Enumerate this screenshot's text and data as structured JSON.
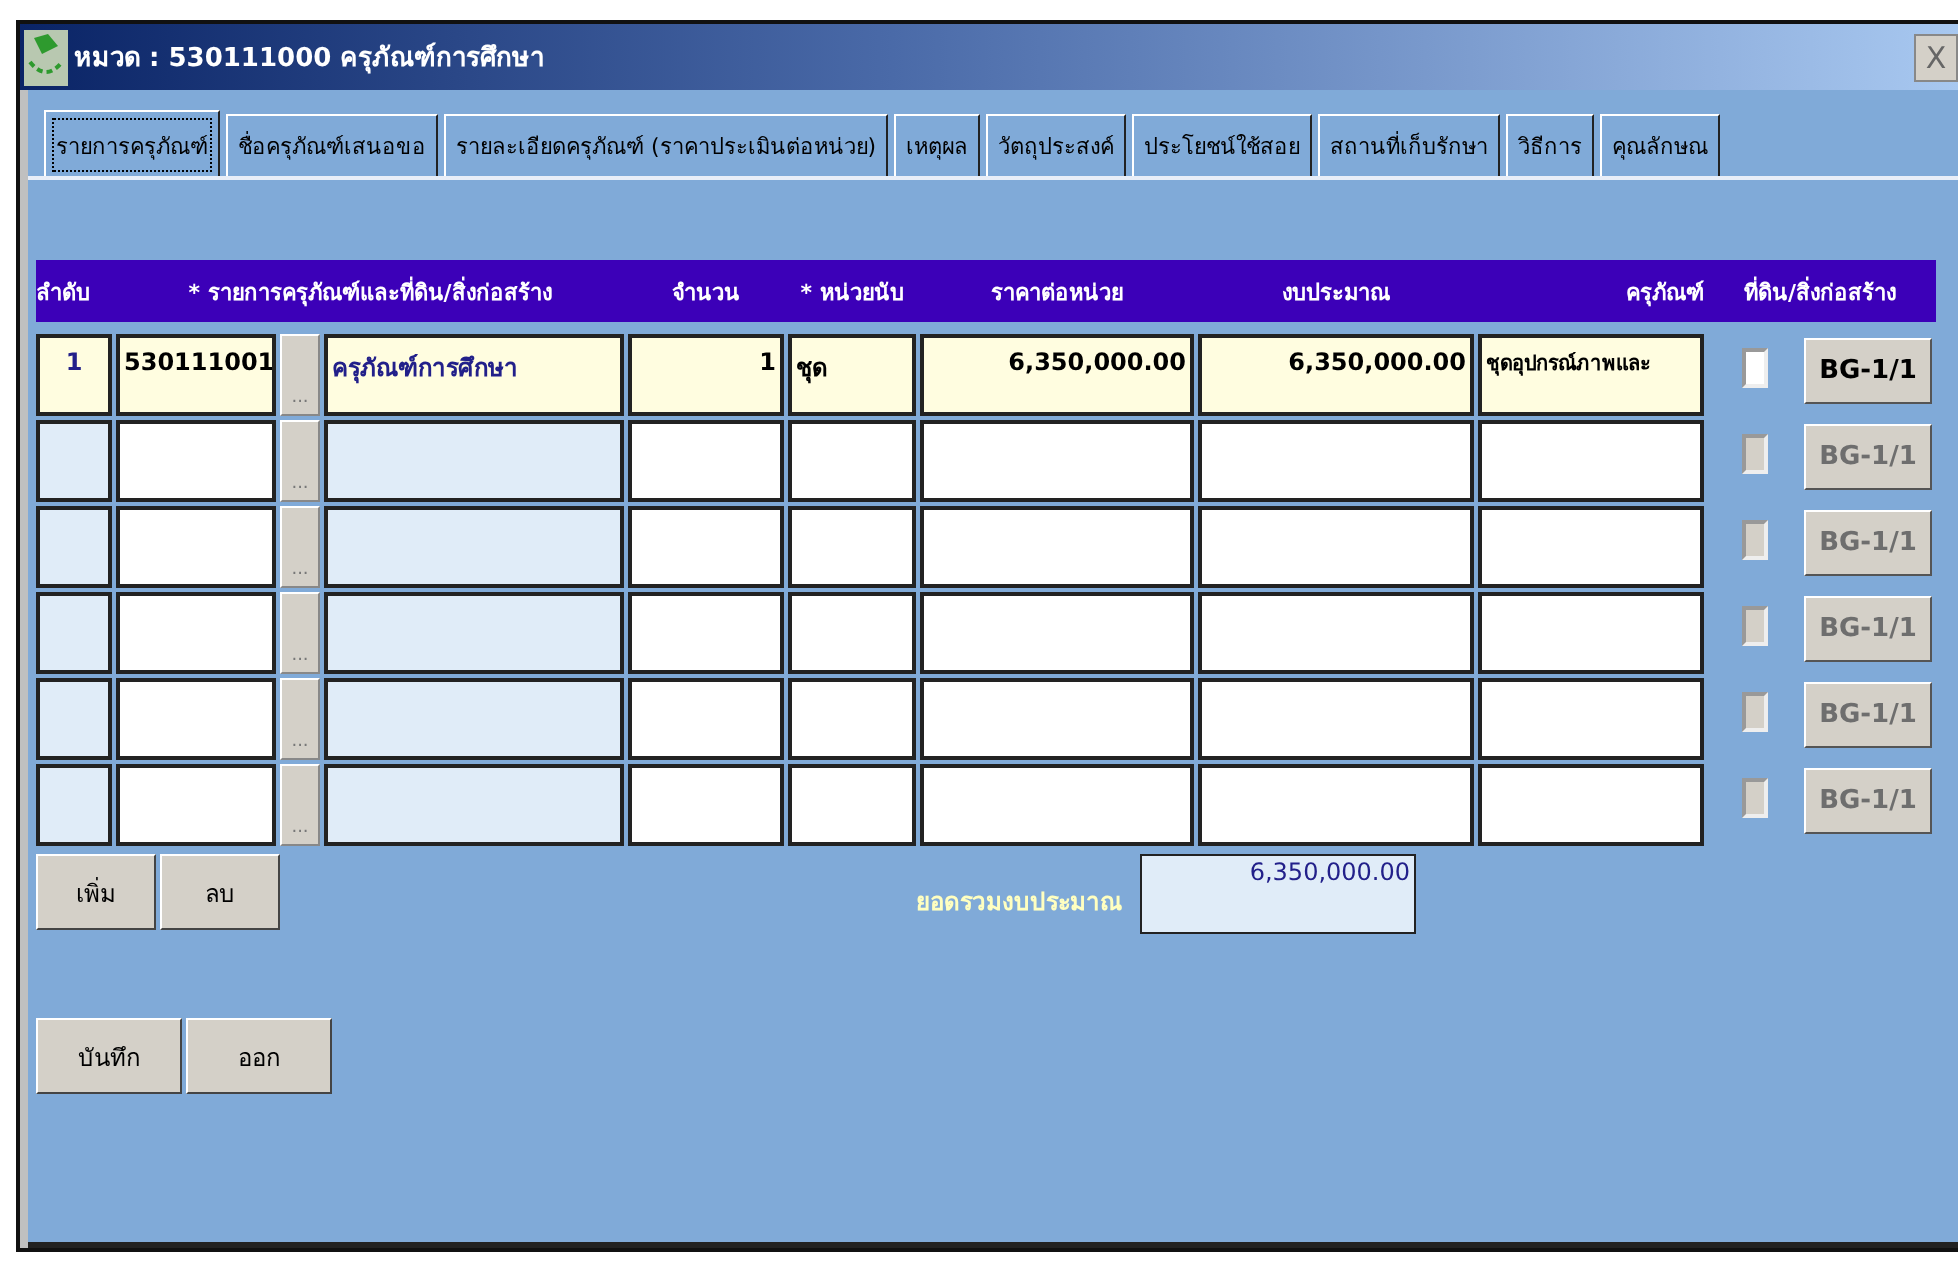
{
  "window": {
    "title": "หมวด : 530111000 ครุภัณฑ์การศึกษา",
    "close": "X"
  },
  "tabs": [
    {
      "label": "รายการครุภัณฑ์",
      "selected": true
    },
    {
      "label": "ชื่อครุภัณฑ์เสนอขอ",
      "selected": false
    },
    {
      "label": "รายละเอียดครุภัณฑ์ (ราคาประเมินต่อหน่วย)",
      "selected": false
    },
    {
      "label": "เหตุผล",
      "selected": false
    },
    {
      "label": "วัตถุประสงค์",
      "selected": false
    },
    {
      "label": "ประโยชน์ใช้สอย",
      "selected": false
    },
    {
      "label": "สถานที่เก็บรักษา",
      "selected": false
    },
    {
      "label": "วิธีการ",
      "selected": false
    },
    {
      "label": "คุณลักษณ",
      "selected": false
    }
  ],
  "table": {
    "columns": [
      "ลำดับ",
      "* รายการครุภัณฑ์และที่ดิน/สิ่งก่อสร้าง",
      "จำนวน",
      "* หน่วยนับ",
      "ราคาต่อหน่วย",
      "งบประมาณ",
      "ครุภัณฑ์",
      "ที่ดิน/สิ่งก่อสร้าง"
    ],
    "rows": [
      {
        "selected": true,
        "disabled": false,
        "seq": "1",
        "code": "530111001",
        "picker": "...",
        "name": "ครุภัณฑ์การศึกษา",
        "qty": "1",
        "unit": "ชุด",
        "price": "6,350,000.00",
        "budget": "6,350,000.00",
        "equipment": "ชุดอุปกรณ์ภาพและ",
        "checked": false,
        "button": "BG-1/1"
      },
      {
        "selected": false,
        "disabled": true,
        "picker": "...",
        "checked": false,
        "button": "BG-1/1"
      },
      {
        "selected": false,
        "disabled": true,
        "picker": "...",
        "checked": false,
        "button": "BG-1/1"
      },
      {
        "selected": false,
        "disabled": true,
        "picker": "...",
        "checked": false,
        "button": "BG-1/1"
      },
      {
        "selected": false,
        "disabled": true,
        "picker": "...",
        "checked": false,
        "button": "BG-1/1"
      },
      {
        "selected": false,
        "disabled": true,
        "picker": "...",
        "checked": false,
        "button": "BG-1/1"
      }
    ]
  },
  "row_buttons": [
    "เพิ่ม",
    "ลบ"
  ],
  "total": {
    "label": "ยอดรวมงบประมาณ",
    "value": "6,350,000.00"
  },
  "buttons": [
    "บันทึก",
    "ออก"
  ]
}
